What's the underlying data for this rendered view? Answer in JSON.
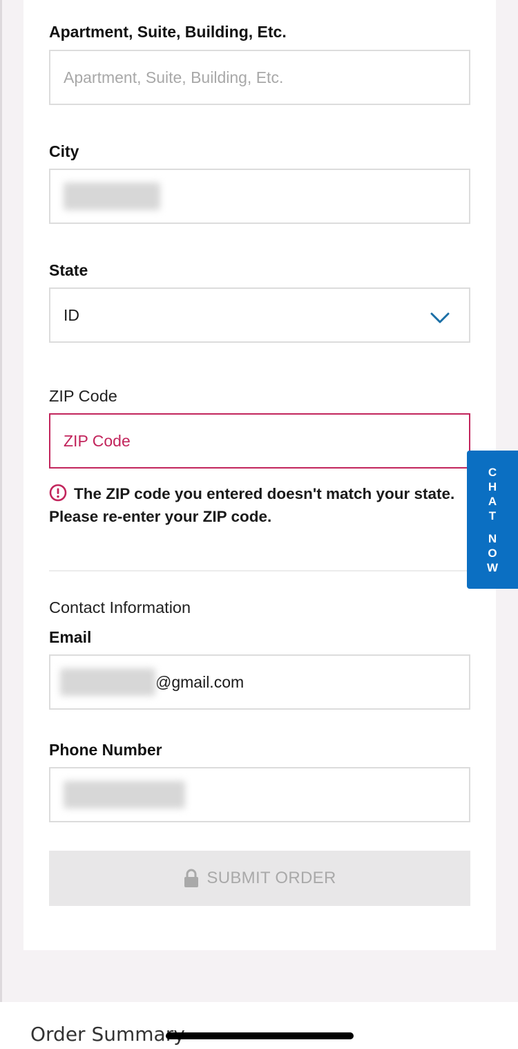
{
  "form": {
    "apartment": {
      "label": "Apartment, Suite, Building, Etc.",
      "placeholder": "Apartment, Suite, Building, Etc."
    },
    "city": {
      "label": "City"
    },
    "state": {
      "label": "State",
      "value": "ID"
    },
    "zip": {
      "label": "ZIP Code",
      "placeholder": "ZIP Code",
      "error": "The ZIP code you entered doesn't match your state. Please re-enter your ZIP code."
    },
    "contact_title": "Contact Information",
    "email": {
      "label": "Email",
      "suffix": "@gmail.com"
    },
    "phone": {
      "label": "Phone Number"
    },
    "submit_label": "SUBMIT ORDER"
  },
  "chat": {
    "line1": [
      "C",
      "H",
      "A",
      "T"
    ],
    "line2": [
      "N",
      "O",
      "W"
    ]
  },
  "footer": {
    "order_summary": "Order Summary"
  },
  "colors": {
    "error": "#c2255c",
    "accent": "#0b6fc2",
    "chevron": "#1b6fa6"
  },
  "icons": [
    "chevron-down-icon",
    "error-icon",
    "lock-icon"
  ]
}
